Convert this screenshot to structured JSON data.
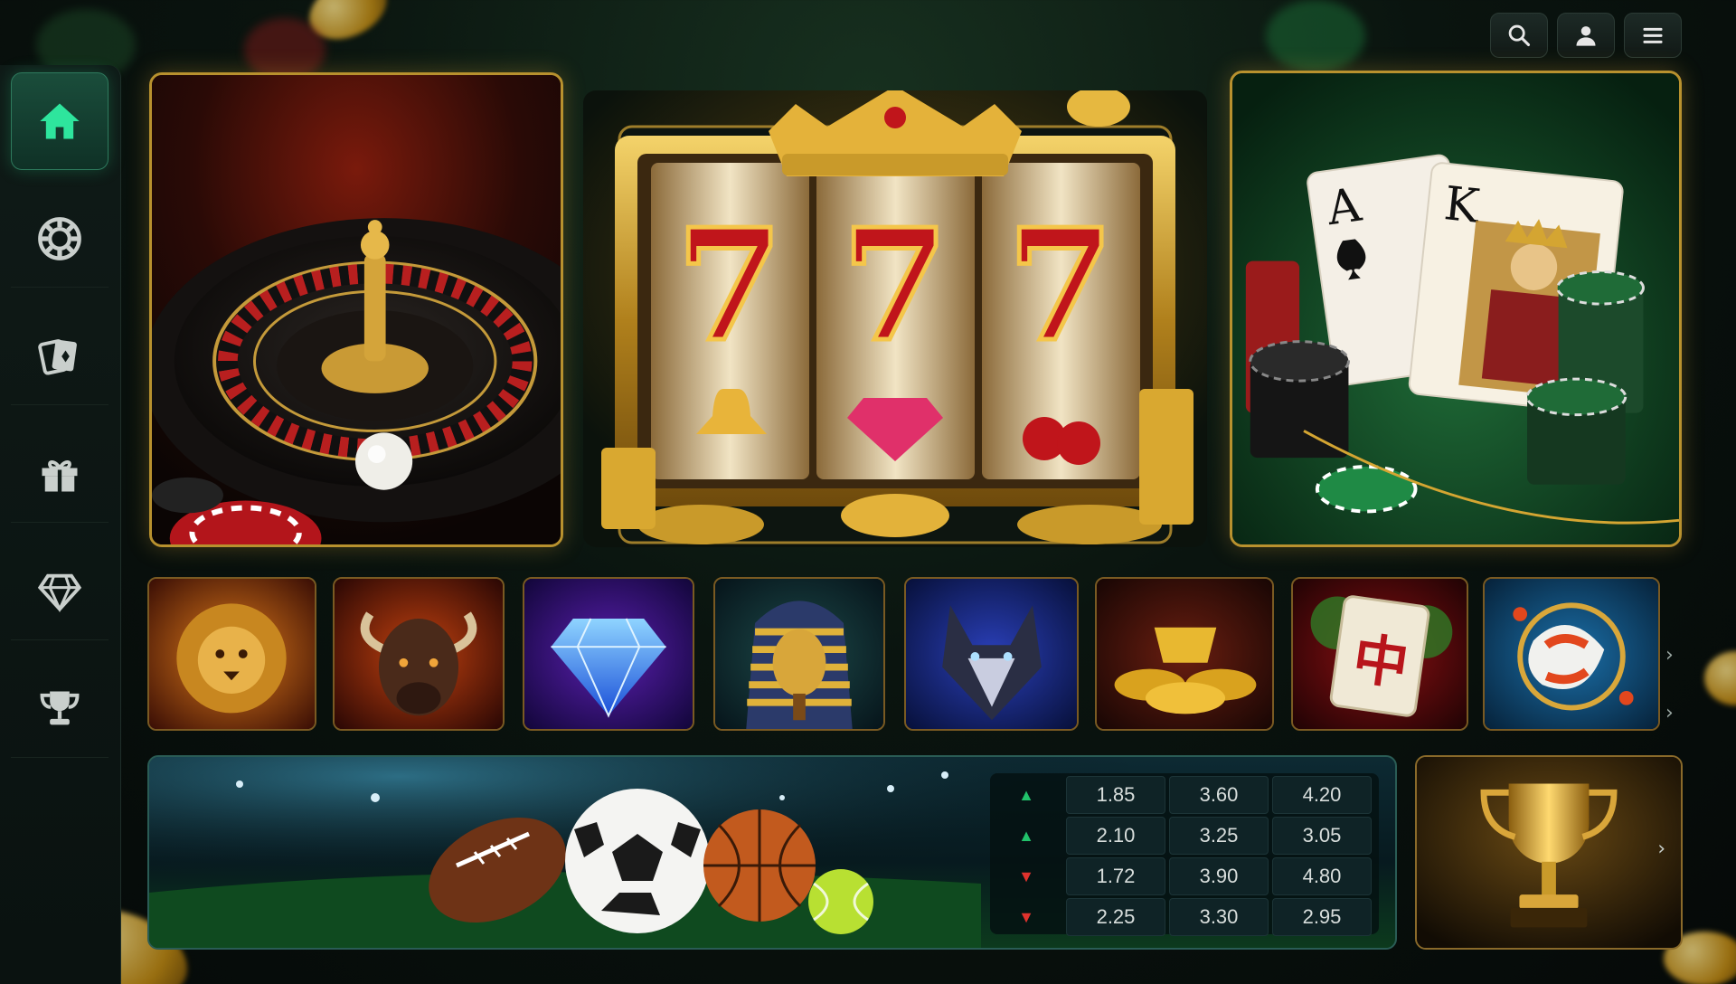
{
  "top_actions": [
    {
      "name": "search",
      "icon": "search-icon"
    },
    {
      "name": "account",
      "icon": "user-icon"
    },
    {
      "name": "menu",
      "icon": "hamburger-menu-icon"
    }
  ],
  "sidebar": {
    "items": [
      {
        "id": "home",
        "icon": "home-icon",
        "active": true
      },
      {
        "id": "casino",
        "icon": "casino-chip-icon",
        "active": false
      },
      {
        "id": "cards",
        "icon": "playing-cards-icon",
        "active": false
      },
      {
        "id": "promotions",
        "icon": "gift-icon",
        "active": false
      },
      {
        "id": "vip",
        "icon": "diamond-icon",
        "active": false
      },
      {
        "id": "tournaments",
        "icon": "trophy-icon",
        "active": false
      }
    ],
    "accent": "#2ee59d"
  },
  "hero": {
    "slots": {
      "reel_symbols": [
        "7",
        "7",
        "7"
      ]
    },
    "cards": {
      "card_1": "A",
      "card_2": "K"
    }
  },
  "games": [
    {
      "theme": "lion"
    },
    {
      "theme": "buffalo"
    },
    {
      "theme": "diamond"
    },
    {
      "theme": "pharaoh"
    },
    {
      "theme": "wolf"
    },
    {
      "theme": "gold-ingots"
    },
    {
      "theme": "mahjong",
      "tile_glyph": "中"
    },
    {
      "theme": "koi"
    }
  ],
  "scroll_indicators": [
    "›",
    "›",
    "›"
  ],
  "sports": {
    "odds": [
      {
        "trend": "up",
        "arrow": "▲",
        "values": [
          "1.85",
          "3.60",
          "4.20"
        ]
      },
      {
        "trend": "up",
        "arrow": "▲",
        "values": [
          "2.10",
          "3.25",
          "3.05"
        ]
      },
      {
        "trend": "down",
        "arrow": "▼",
        "values": [
          "1.72",
          "3.90",
          "4.80"
        ]
      },
      {
        "trend": "down",
        "arrow": "▼",
        "values": [
          "2.25",
          "3.30",
          "2.95"
        ]
      }
    ],
    "colors": {
      "up": "#21c26b",
      "down": "#e0322d"
    }
  },
  "colors": {
    "gold": "#d4a532",
    "background": "#0a140f"
  }
}
